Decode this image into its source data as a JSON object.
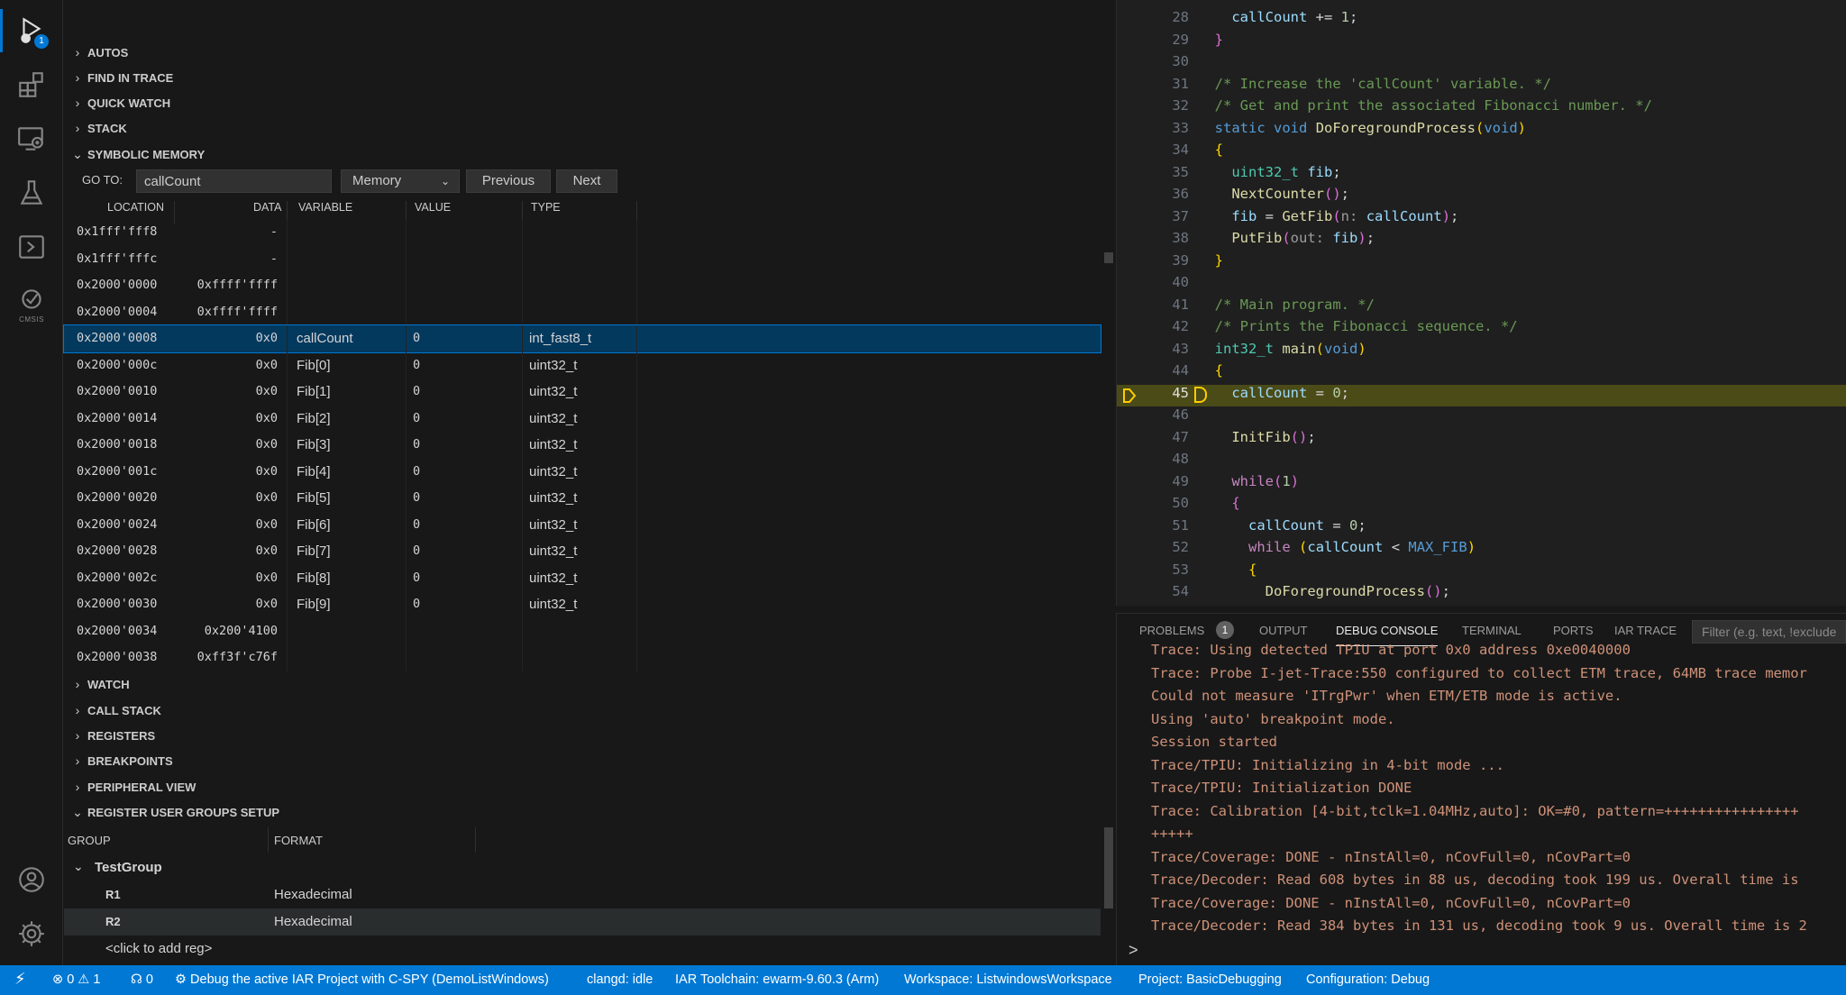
{
  "activity_bar": {
    "run_debug_badge": "1",
    "cmsis_label": "CMSIS",
    "icons": [
      "run-debug-icon",
      "extensions-icon",
      "remote-explorer-icon",
      "testing-icon",
      "terminal-icon",
      "cmsis-icon",
      "account-icon",
      "settings-gear-icon"
    ]
  },
  "sidebar": {
    "sections_top": [
      "AUTOS",
      "FIND IN TRACE",
      "QUICK WATCH",
      "STACK"
    ],
    "symbolic_memory": {
      "title": "SYMBOLIC MEMORY",
      "goto_label": "GO TO:",
      "goto_value": "callCount",
      "memory_select": "Memory",
      "previous": "Previous",
      "next": "Next",
      "columns": [
        "LOCATION",
        "DATA",
        "VARIABLE",
        "VALUE",
        "TYPE"
      ],
      "rows": [
        {
          "loc": "0x1fff'fff8",
          "data": "-",
          "var": "",
          "val": "",
          "type": ""
        },
        {
          "loc": "0x1fff'fffc",
          "data": "-",
          "var": "",
          "val": "",
          "type": ""
        },
        {
          "loc": "0x2000'0000",
          "data": "0xffff'ffff",
          "var": "",
          "val": "",
          "type": ""
        },
        {
          "loc": "0x2000'0004",
          "data": "0xffff'ffff",
          "var": "",
          "val": "",
          "type": ""
        },
        {
          "loc": "0x2000'0008",
          "data": "0x0",
          "var": "callCount",
          "val": "0",
          "type": "int_fast8_t"
        },
        {
          "loc": "0x2000'000c",
          "data": "0x0",
          "var": "Fib[0]",
          "val": "0",
          "type": "uint32_t"
        },
        {
          "loc": "0x2000'0010",
          "data": "0x0",
          "var": "Fib[1]",
          "val": "0",
          "type": "uint32_t"
        },
        {
          "loc": "0x2000'0014",
          "data": "0x0",
          "var": "Fib[2]",
          "val": "0",
          "type": "uint32_t"
        },
        {
          "loc": "0x2000'0018",
          "data": "0x0",
          "var": "Fib[3]",
          "val": "0",
          "type": "uint32_t"
        },
        {
          "loc": "0x2000'001c",
          "data": "0x0",
          "var": "Fib[4]",
          "val": "0",
          "type": "uint32_t"
        },
        {
          "loc": "0x2000'0020",
          "data": "0x0",
          "var": "Fib[5]",
          "val": "0",
          "type": "uint32_t"
        },
        {
          "loc": "0x2000'0024",
          "data": "0x0",
          "var": "Fib[6]",
          "val": "0",
          "type": "uint32_t"
        },
        {
          "loc": "0x2000'0028",
          "data": "0x0",
          "var": "Fib[7]",
          "val": "0",
          "type": "uint32_t"
        },
        {
          "loc": "0x2000'002c",
          "data": "0x0",
          "var": "Fib[8]",
          "val": "0",
          "type": "uint32_t"
        },
        {
          "loc": "0x2000'0030",
          "data": "0x0",
          "var": "Fib[9]",
          "val": "0",
          "type": "uint32_t"
        },
        {
          "loc": "0x2000'0034",
          "data": "0x200'4100",
          "var": "",
          "val": "",
          "type": ""
        },
        {
          "loc": "0x2000'0038",
          "data": "0xff3f'c76f",
          "var": "",
          "val": "",
          "type": ""
        }
      ]
    },
    "sections_bottom": [
      "WATCH",
      "CALL STACK",
      "REGISTERS",
      "BREAKPOINTS",
      "PERIPHERAL VIEW"
    ],
    "register_groups": {
      "title": "REGISTER USER GROUPS SETUP",
      "columns": [
        "GROUP",
        "FORMAT"
      ],
      "group_name": "TestGroup",
      "regs": [
        {
          "name": "R1",
          "format": "Hexadecimal"
        },
        {
          "name": "R2",
          "format": "Hexadecimal"
        }
      ],
      "add_reg": "<click to add reg>"
    }
  },
  "editor": {
    "lines": [
      {
        "n": "28",
        "html": "    <span class='vr'>callCount</span> += <span class='nm'>1</span>;"
      },
      {
        "n": "29",
        "html": "  <span class='br2'>}</span>"
      },
      {
        "n": "30",
        "html": ""
      },
      {
        "n": "31",
        "html": "  <span class='cm'>/* Increase the 'callCount' variable. */</span>"
      },
      {
        "n": "32",
        "html": "  <span class='cm'>/* Get and print the associated Fibonacci number. */</span>"
      },
      {
        "n": "33",
        "html": "  <span class='kw'>static</span> <span class='kw'>void</span> <span class='fn'>DoForegroundProcess</span><span class='br'>(</span><span class='kw'>void</span><span class='br'>)</span>"
      },
      {
        "n": "34",
        "html": "  <span class='br'>{</span>"
      },
      {
        "n": "35",
        "html": "    <span class='ty'>uint32_t</span> <span class='vr'>fib</span>;"
      },
      {
        "n": "36",
        "html": "    <span class='fn'>NextCounter</span><span class='br2'>()</span>;"
      },
      {
        "n": "37",
        "html": "    <span class='vr'>fib</span> = <span class='fn'>GetFib</span><span class='br2'>(</span><span class='hint'>n:</span> <span class='vr'>callCount</span><span class='br2'>)</span>;"
      },
      {
        "n": "38",
        "html": "    <span class='fn'>PutFib</span><span class='br2'>(</span><span class='hint'>out:</span> <span class='vr'>fib</span><span class='br2'>)</span>;"
      },
      {
        "n": "39",
        "html": "  <span class='br'>}</span>"
      },
      {
        "n": "40",
        "html": ""
      },
      {
        "n": "41",
        "html": "  <span class='cm'>/* Main program. */</span>"
      },
      {
        "n": "42",
        "html": "  <span class='cm'>/* Prints the Fibonacci sequence. */</span>"
      },
      {
        "n": "43",
        "html": "  <span class='ty'>int32_t</span> <span class='fn'>main</span><span class='br'>(</span><span class='kw'>void</span><span class='br'>)</span>"
      },
      {
        "n": "44",
        "html": "  <span class='br'>{</span>"
      },
      {
        "n": "45",
        "html": "    <span class='vr'>callCount</span> = <span class='nm'>0</span>;",
        "current": true
      },
      {
        "n": "46",
        "html": ""
      },
      {
        "n": "47",
        "html": "    <span class='fn'>InitFib</span><span class='br2'>()</span>;"
      },
      {
        "n": "48",
        "html": ""
      },
      {
        "n": "49",
        "html": "    <span class='ctl'>while</span><span class='br2'>(</span><span class='nm'>1</span><span class='br2'>)</span>"
      },
      {
        "n": "50",
        "html": "    <span class='br2'>{</span>"
      },
      {
        "n": "51",
        "html": "      <span class='vr'>callCount</span> = <span class='nm'>0</span>;"
      },
      {
        "n": "52",
        "html": "      <span class='ctl'>while</span> <span class='br'>(</span><span class='vr'>callCount</span> &lt; <span class='kw'>MAX_FIB</span><span class='br'>)</span>"
      },
      {
        "n": "53",
        "html": "      <span class='br'>{</span>"
      },
      {
        "n": "54",
        "html": "        <span class='fn'>DoForegroundProcess</span><span class='br2'>()</span>;"
      }
    ]
  },
  "panel": {
    "tabs": [
      "PROBLEMS",
      "OUTPUT",
      "DEBUG CONSOLE",
      "TERMINAL",
      "PORTS",
      "IAR TRACE"
    ],
    "problems_count": "1",
    "filter_placeholder": "Filter (e.g. text, !exclude",
    "console_lines": [
      "Trace: Using detected TPIU at port 0x0 address 0xe0040000",
      "Trace: Probe I-jet-Trace:550 configured to collect ETM trace, 64MB trace memor",
      "Could not measure 'ITrgPwr' when ETM/ETB mode is active.",
      "Using 'auto' breakpoint mode.",
      "Session started",
      "Trace/TPIU: Initializing in 4-bit mode ...",
      "Trace/TPIU: Initialization DONE",
      "Trace: Calibration [4-bit,tclk=1.04MHz,auto]: OK=#0, pattern=++++++++++++++++",
      "+++++",
      "Trace/Coverage: DONE - nInstAll=0, nCovFull=0, nCovPart=0",
      "Trace/Decoder: Read 608 bytes in 88 us, decoding took 199 us. Overall time is",
      "Trace/Coverage: DONE - nInstAll=0, nCovFull=0, nCovPart=0",
      "Trace/Decoder: Read 384 bytes in 131 us, decoding took 9 us. Overall time is 2"
    ],
    "prompt": ">"
  },
  "status_bar": {
    "errors": "0",
    "warnings": "1",
    "ports": "0",
    "debug": "Debug the active IAR Project with C-SPY (DemoListWindows)",
    "clangd": "clangd: idle",
    "toolchain": "IAR Toolchain: ewarm-9.60.3 (Arm)",
    "workspace": "Workspace: ListwindowsWorkspace",
    "project": "Project: BasicDebugging",
    "configuration": "Configuration: Debug"
  }
}
